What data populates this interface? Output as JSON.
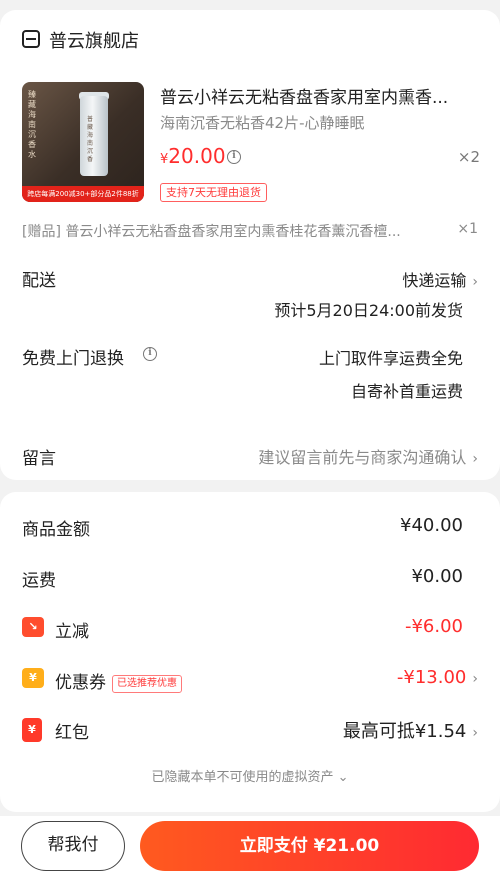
{
  "store": {
    "name": "普云旗舰店"
  },
  "product": {
    "title": "普云小祥云无粘香盘香家用室内熏香...",
    "spec": "海南沉香无粘香42片-心静睡眠",
    "price_symbol": "¥",
    "price": "20.00",
    "qty": "×2",
    "refund_tag": "支持7天无理由退货",
    "image": {
      "vertical_text": "臻藏海南沉香水",
      "tube_text": "普藏海南沉香",
      "promo_text": "跨店每满200减30+部分品2件88折"
    }
  },
  "gift": {
    "text": "[赠品] 普云小祥云无粘香盘香家用室内熏香桂花香薰沉香檀...",
    "qty": "×1"
  },
  "delivery": {
    "label": "配送",
    "method": "快递运输",
    "eta": "预计5月20日24:00前发货"
  },
  "return": {
    "label": "免费上门退换",
    "line1": "上门取件享运费全免",
    "line2": "自寄补首重运费"
  },
  "message": {
    "label": "留言",
    "placeholder": "建议留言前先与商家沟通确认"
  },
  "summary": {
    "goods_label": "商品金额",
    "goods_value": "¥40.00",
    "shipping_label": "运费",
    "shipping_value": "¥0.00",
    "discount_label": "立减",
    "discount_value": "-¥6.00",
    "coupon_label": "优惠券",
    "coupon_tag": "已选推荐优惠",
    "coupon_value": "-¥13.00",
    "redpacket_label": "红包",
    "redpacket_value": "最高可抵¥1.54",
    "hidden_assets": "已隐藏本单不可使用的虚拟资产"
  },
  "footer": {
    "help_label": "帮我付",
    "pay_label": "立即支付 ¥21.00"
  },
  "colors": {
    "accent": "#ff2d2d",
    "pay_gradient_start": "#ff5a1f",
    "pay_gradient_end": "#ff2a32"
  }
}
